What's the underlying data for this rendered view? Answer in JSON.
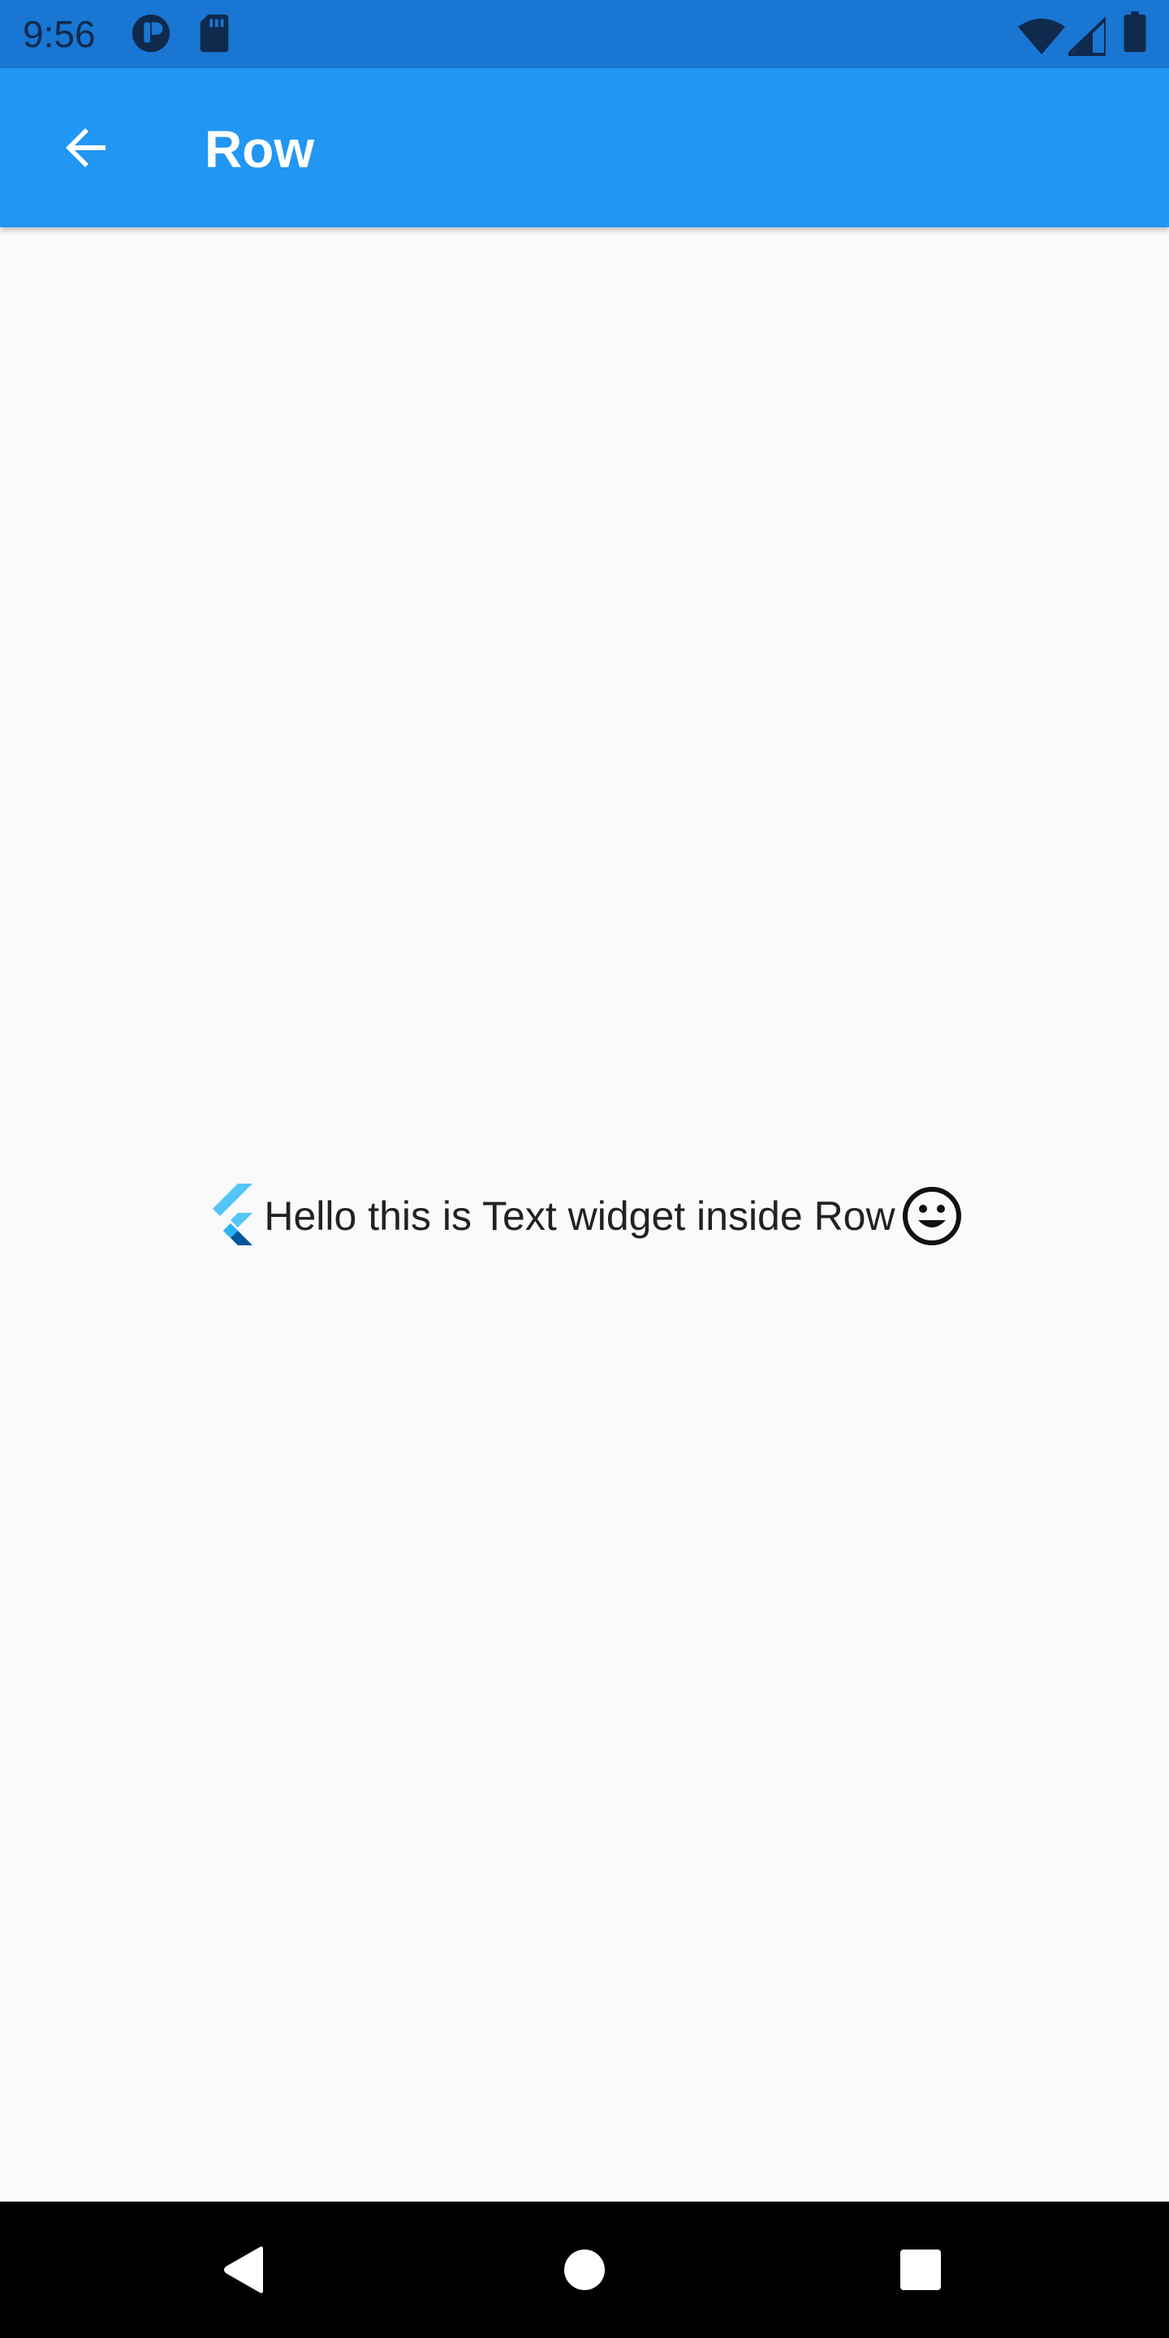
{
  "status_bar": {
    "time": "9:56",
    "background": "#1976d2"
  },
  "app_bar": {
    "title": "Row",
    "background": "#2196f3",
    "back_icon": "arrow-back-icon"
  },
  "content": {
    "row_text": "Hello this is Text widget inside Row",
    "leading_icon": "flutter-logo-icon",
    "trailing_icon": "smiley-face-icon"
  },
  "nav_bar": {
    "back_icon": "triangle-back-icon",
    "home_icon": "circle-home-icon",
    "recents_icon": "square-recents-icon"
  }
}
